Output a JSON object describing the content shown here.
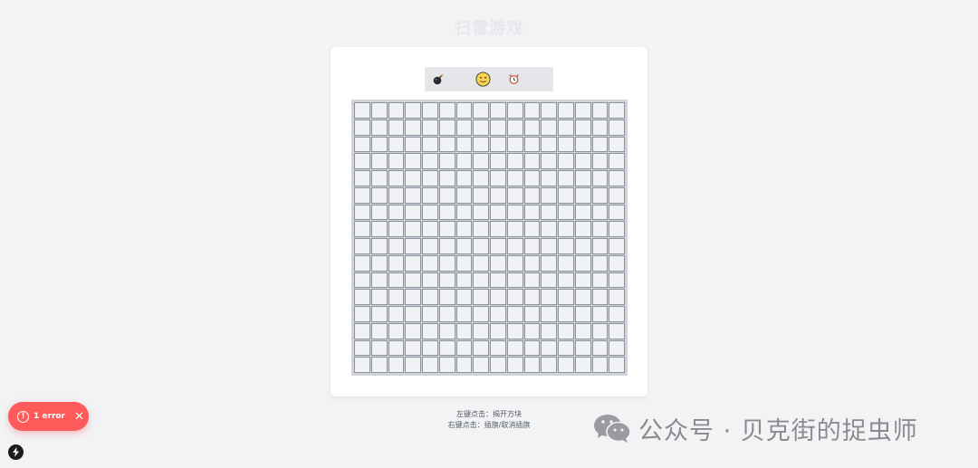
{
  "page": {
    "title": "扫雷游戏"
  },
  "status_bar": {
    "mine_icon": "bomb-icon",
    "face_icon": "smiley-face-icon",
    "timer_icon": "alarm-clock-icon",
    "mines_left": "",
    "timer": ""
  },
  "board": {
    "rows": 16,
    "cols": 16,
    "cell_state": "unrevealed"
  },
  "instructions": {
    "left_click": "左键点击：揭开方块",
    "right_click": "右键点击：插旗/取消插旗"
  },
  "error_toast": {
    "label": "1 error",
    "icon": "alert-circle-icon",
    "close_icon": "close-icon"
  },
  "dev_indicator": {
    "icon": "lightning-icon"
  },
  "watermark": {
    "text": "公众号 · 贝克街的捉虫师",
    "icon": "wechat-icon"
  },
  "colors": {
    "background": "#f2f3f5",
    "card": "#ffffff",
    "cell": "#f1f2f5",
    "cell_border": "#8d929c",
    "board_frame": "#cfd2d8",
    "error": "#ff5a5a"
  }
}
